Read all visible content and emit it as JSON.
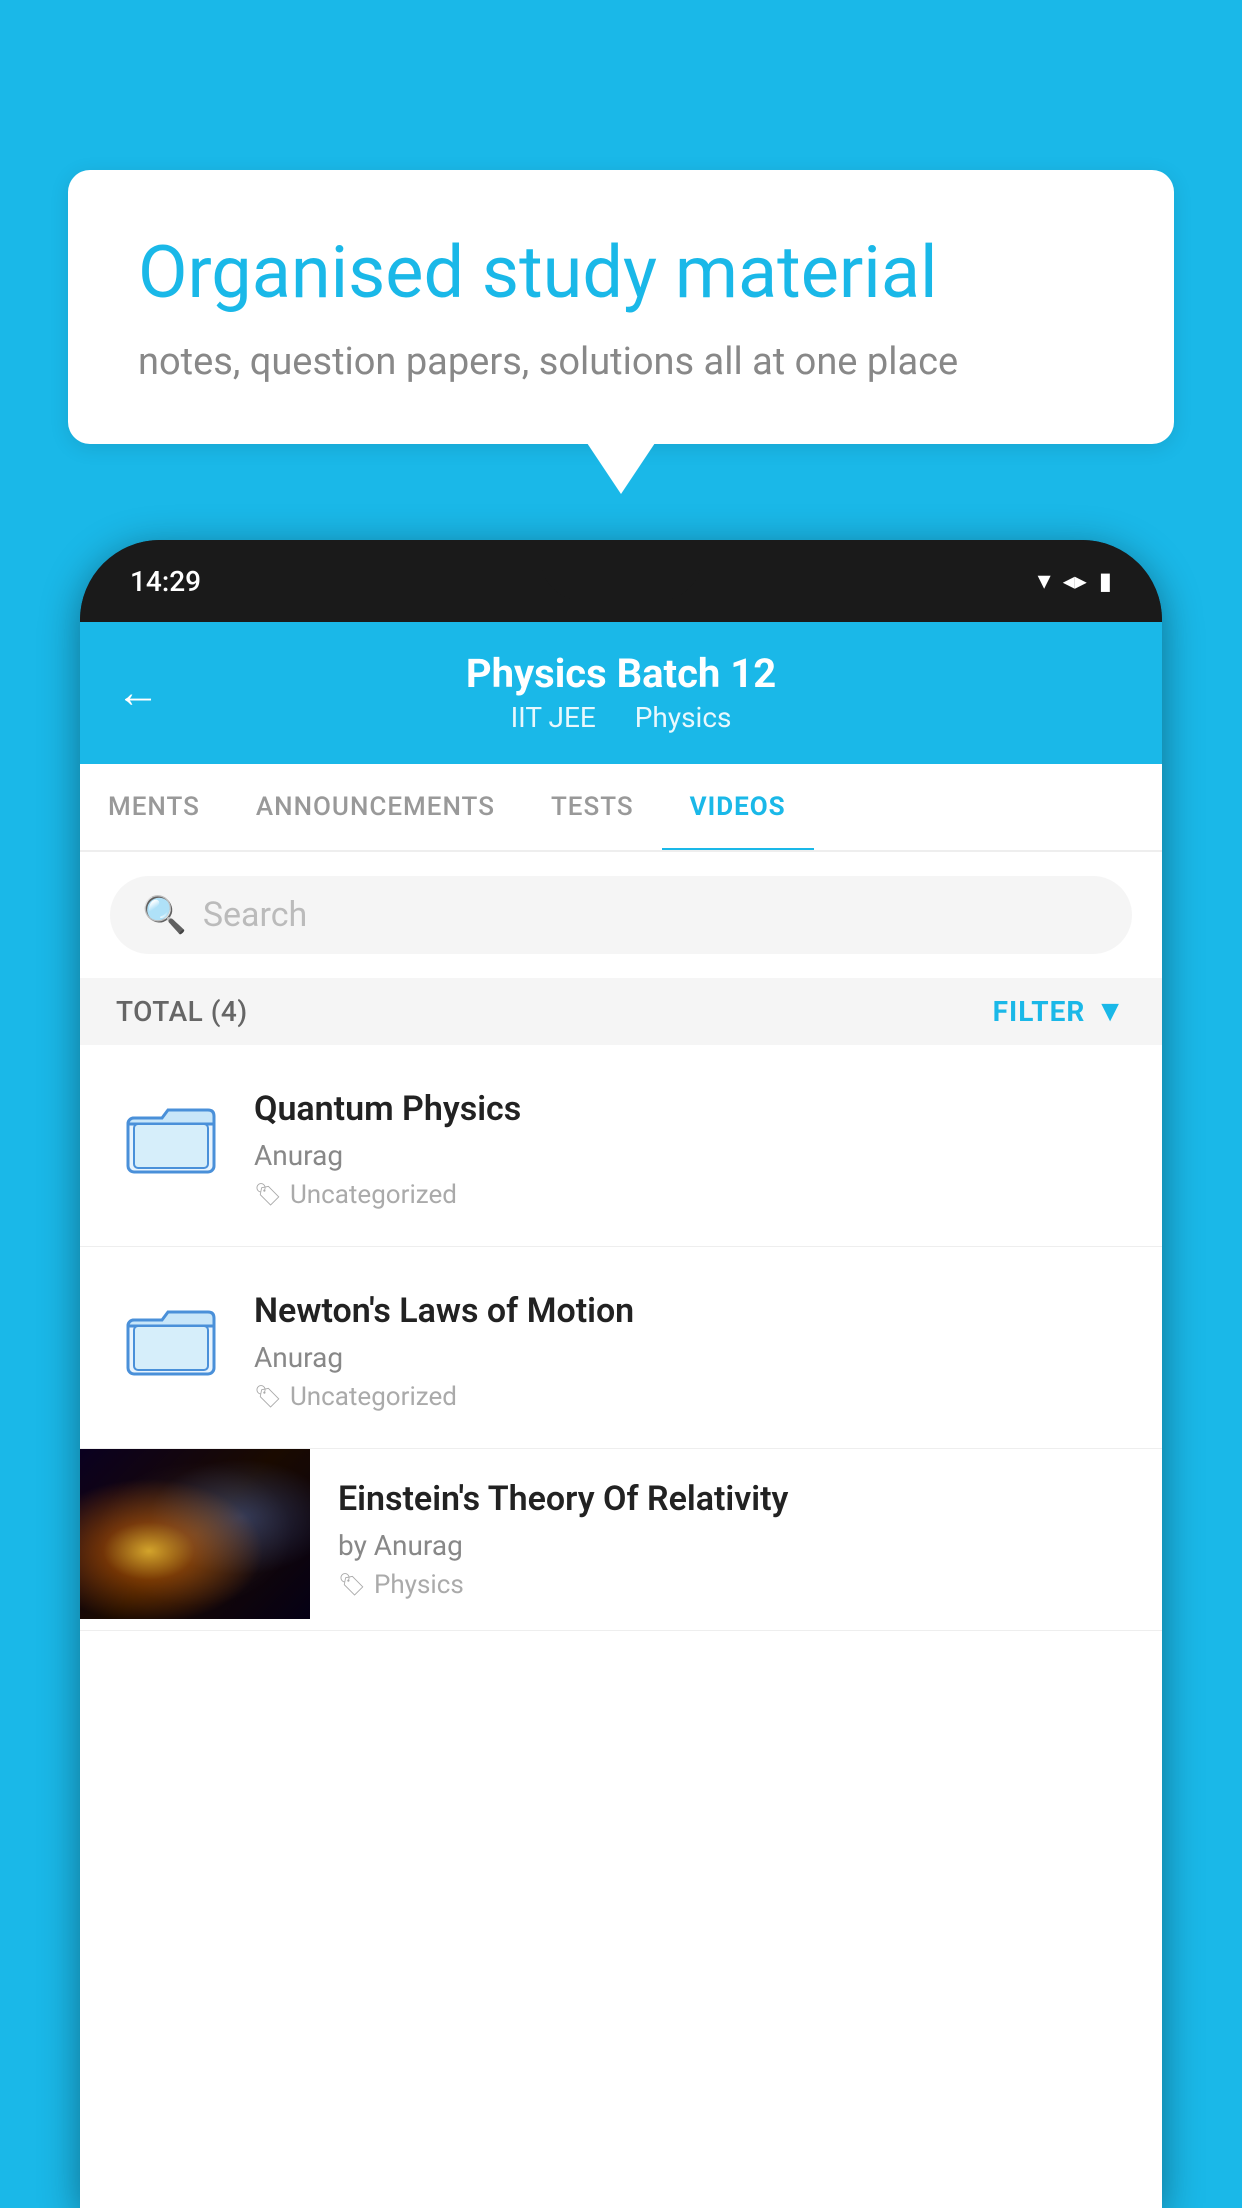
{
  "background_color": "#1ab8e8",
  "speech_bubble": {
    "title": "Organised study material",
    "subtitle": "notes, question papers, solutions all at one place"
  },
  "phone": {
    "status_bar": {
      "time": "14:29"
    },
    "header": {
      "back_label": "←",
      "title": "Physics Batch 12",
      "subtitle_part1": "IIT JEE",
      "subtitle_part2": "Physics"
    },
    "tabs": [
      {
        "label": "MENTS",
        "active": false
      },
      {
        "label": "ANNOUNCEMENTS",
        "active": false
      },
      {
        "label": "TESTS",
        "active": false
      },
      {
        "label": "VIDEOS",
        "active": true
      }
    ],
    "search": {
      "placeholder": "Search"
    },
    "filter_bar": {
      "total_label": "TOTAL (4)",
      "filter_label": "FILTER"
    },
    "videos": [
      {
        "id": 1,
        "title": "Quantum Physics",
        "author": "Anurag",
        "tag": "Uncategorized",
        "has_thumbnail": false
      },
      {
        "id": 2,
        "title": "Newton's Laws of Motion",
        "author": "Anurag",
        "tag": "Uncategorized",
        "has_thumbnail": false
      },
      {
        "id": 3,
        "title": "Einstein's Theory Of Relativity",
        "author": "by Anurag",
        "tag": "Physics",
        "has_thumbnail": true
      }
    ]
  }
}
